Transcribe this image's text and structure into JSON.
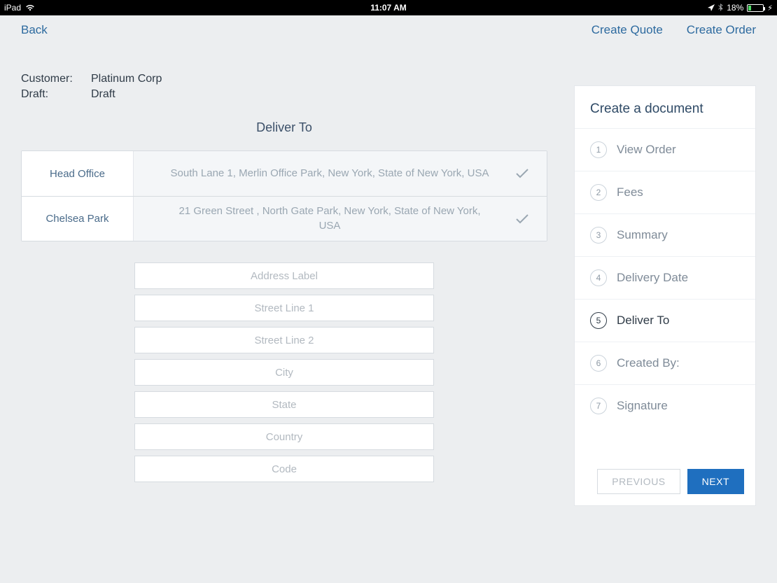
{
  "status_bar": {
    "carrier": "iPad",
    "time": "11:07 AM",
    "battery_text": "18%"
  },
  "nav": {
    "back": "Back",
    "create_quote": "Create Quote",
    "create_order": "Create Order"
  },
  "header": {
    "customer_label": "Customer:",
    "customer_value": "Platinum Corp",
    "draft_label": "Draft:",
    "draft_value": "Draft"
  },
  "section_title": "Deliver To",
  "addresses": [
    {
      "name": "Head Office",
      "text": "South Lane 1, Merlin Office Park, New York, State of New York, USA"
    },
    {
      "name": "Chelsea Park",
      "text": "21 Green Street , North Gate Park, New York, State of New York, USA"
    }
  ],
  "inputs": {
    "address_label": "Address Label",
    "street1": "Street Line 1",
    "street2": "Street Line 2",
    "city": "City",
    "state": "State",
    "country": "Country",
    "code": "Code"
  },
  "sidebar": {
    "title": "Create a document",
    "steps": [
      {
        "num": "1",
        "label": "View Order"
      },
      {
        "num": "2",
        "label": "Fees"
      },
      {
        "num": "3",
        "label": "Summary"
      },
      {
        "num": "4",
        "label": "Delivery Date"
      },
      {
        "num": "5",
        "label": "Deliver To"
      },
      {
        "num": "6",
        "label": "Created By:"
      },
      {
        "num": "7",
        "label": "Signature"
      }
    ],
    "active_step_index": 4,
    "previous": "PREVIOUS",
    "next": "NEXT"
  }
}
